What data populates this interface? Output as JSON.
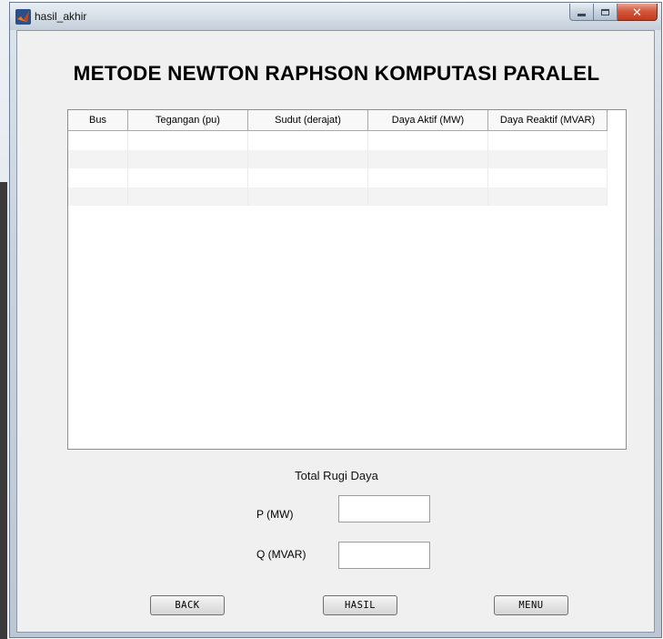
{
  "window": {
    "title": "hasil_akhir"
  },
  "heading": "METODE NEWTON RAPHSON KOMPUTASI PARALEL",
  "table": {
    "columns": [
      "Bus",
      "Tegangan (pu)",
      "Sudut (derajat)",
      "Daya Aktif (MW)",
      "Daya Reaktif (MVAR)"
    ],
    "rows": [
      [
        "",
        "",
        "",
        "",
        ""
      ],
      [
        "",
        "",
        "",
        "",
        ""
      ],
      [
        "",
        "",
        "",
        "",
        ""
      ],
      [
        "",
        "",
        "",
        "",
        ""
      ]
    ]
  },
  "losses": {
    "title": "Total Rugi Daya",
    "p_label": "P (MW)",
    "p_value": "",
    "q_label": "Q (MVAR)",
    "q_value": ""
  },
  "buttons": {
    "back": "BACK",
    "hasil": "HASIL",
    "menu": "MENU"
  },
  "colors": {
    "client_bg": "#f0f0f0",
    "close_button": "#c23a1b",
    "row_alt": "#f3f3f3"
  }
}
